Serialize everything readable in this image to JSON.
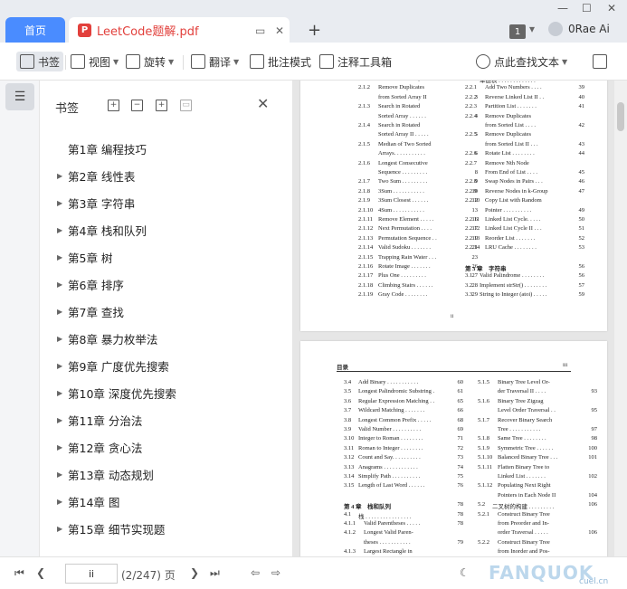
{
  "tabs": {
    "home_label": "首页",
    "doc_icon_text": "P",
    "doc_label": "LeetCode题解.pdf"
  },
  "titlebar": {
    "badge_number": "1",
    "user_name": "0Rae Ai"
  },
  "toolbar": {
    "bookmark": "书签",
    "view": "视图",
    "rotate": "旋转",
    "translate": "翻译",
    "annotate_mode": "批注模式",
    "annotate_tools": "注释工具箱",
    "search": "点此查找文本"
  },
  "panel": {
    "title": "书签",
    "items": [
      {
        "label": "第1章  编程技巧",
        "expandable": false
      },
      {
        "label": "第2章  线性表",
        "expandable": true
      },
      {
        "label": "第3章  字符串",
        "expandable": true
      },
      {
        "label": "第4章  栈和队列",
        "expandable": true
      },
      {
        "label": "第5章  树",
        "expandable": true
      },
      {
        "label": "第6章  排序",
        "expandable": true
      },
      {
        "label": "第7章  查找",
        "expandable": true
      },
      {
        "label": "第8章  暴力枚举法",
        "expandable": true
      },
      {
        "label": "第9章  广度优先搜索",
        "expandable": true
      },
      {
        "label": "第10章  深度优先搜索",
        "expandable": true
      },
      {
        "label": "第11章  分治法",
        "expandable": true
      },
      {
        "label": "第12章  贪心法",
        "expandable": true
      },
      {
        "label": "第13章  动态规划",
        "expandable": true
      },
      {
        "label": "第14章  图",
        "expandable": true
      },
      {
        "label": "第15章  细节实现题",
        "expandable": true
      }
    ]
  },
  "page1": {
    "left": [
      {
        "n": "",
        "t": "from Sorted Array",
        "p": "2"
      },
      {
        "n": "2.1.2",
        "t": "Remove      Duplicates",
        "p": ""
      },
      {
        "n": "",
        "t": "from Sorted Array II",
        "p": "3"
      },
      {
        "n": "2.1.3",
        "t": "Search      in      Rotated",
        "p": ""
      },
      {
        "n": "",
        "t": "Sorted Array . . . . . .",
        "p": "4"
      },
      {
        "n": "2.1.4",
        "t": "Search      in      Rotated",
        "p": ""
      },
      {
        "n": "",
        "t": "Sorted Array II . . . . .",
        "p": "5"
      },
      {
        "n": "2.1.5",
        "t": "Median of Two Sorted",
        "p": ""
      },
      {
        "n": "",
        "t": "Arrays. . . . . . . . . . .",
        "p": "6"
      },
      {
        "n": "2.1.6",
        "t": "Longest   Consecutive",
        "p": ""
      },
      {
        "n": "",
        "t": "Sequence . . . . . . . . .",
        "p": "8"
      },
      {
        "n": "2.1.7",
        "t": "Two Sum . . . . . . . . .",
        "p": "9"
      },
      {
        "n": "2.1.8",
        "t": "3Sum . . . . . . . . . . .",
        "p": "10"
      },
      {
        "n": "2.1.9",
        "t": "3Sum Closest . . . . . .",
        "p": "12"
      },
      {
        "n": "2.1.10",
        "t": "4Sum . . . . . . . . . . .",
        "p": "13"
      },
      {
        "n": "2.1.11",
        "t": "Remove Element . . . . .",
        "p": "16"
      },
      {
        "n": "2.1.12",
        "t": "Next Permutation . . . .",
        "p": "17"
      },
      {
        "n": "2.1.13",
        "t": "Permutation Sequence . .",
        "p": "19"
      },
      {
        "n": "2.1.14",
        "t": "Valid Sudoku . . . . . . .",
        "p": "21"
      },
      {
        "n": "2.1.15",
        "t": "Trapping Rain Water . . .",
        "p": "23"
      },
      {
        "n": "2.1.16",
        "t": "Rotate Image . . . . . . .",
        "p": "26"
      },
      {
        "n": "2.1.17",
        "t": "Plus One . . . . . . . . .",
        "p": "27"
      },
      {
        "n": "2.1.18",
        "t": "Climbing Stairs . . . . . .",
        "p": "28"
      },
      {
        "n": "2.1.19",
        "t": "Gray Code . . . . . . . .",
        "p": "29"
      }
    ],
    "right": [
      {
        "n": "2.2",
        "t": "单链表 . . . . . . . . . . . . .",
        "p": "38"
      },
      {
        "n": "2.2.1",
        "t": "Add Two Numbers . . . .",
        "p": "39"
      },
      {
        "n": "2.2.2",
        "t": "Reverse Linked List II . .",
        "p": "40"
      },
      {
        "n": "2.2.3",
        "t": "Partition List . . . . . . .",
        "p": "41"
      },
      {
        "n": "2.2.4",
        "t": "Remove      Duplicates",
        "p": ""
      },
      {
        "n": "",
        "t": "from Sorted List . . . .",
        "p": "42"
      },
      {
        "n": "2.2.5",
        "t": "Remove      Duplicates",
        "p": ""
      },
      {
        "n": "",
        "t": "from Sorted List II . . .",
        "p": "43"
      },
      {
        "n": "2.2.6",
        "t": "Rotate List . . . . . . . .",
        "p": "44"
      },
      {
        "n": "2.2.7",
        "t": "Remove   Nth   Node",
        "p": ""
      },
      {
        "n": "",
        "t": "From End of List . . . .",
        "p": "45"
      },
      {
        "n": "2.2.8",
        "t": "Swap Nodes in Pairs . . .",
        "p": "46"
      },
      {
        "n": "2.2.9",
        "t": "Reverse Nodes in k-Group",
        "p": "47"
      },
      {
        "n": "2.2.10",
        "t": "Copy List with Random",
        "p": ""
      },
      {
        "n": "",
        "t": "Pointer . . . . . . . . . .",
        "p": "49"
      },
      {
        "n": "2.2.11",
        "t": "Linked List Cycle. . . . .",
        "p": "50"
      },
      {
        "n": "2.2.12",
        "t": "Linked List Cycle II . . .",
        "p": "51"
      },
      {
        "n": "2.2.13",
        "t": "Reorder List . . . . . . .",
        "p": "52"
      },
      {
        "n": "2.2.14",
        "t": "LRU Cache . . . . . . . .",
        "p": "53"
      },
      {
        "n": "",
        "t": "",
        "p": ""
      },
      {
        "n": "第 3 章",
        "t": "字符串",
        "p": "56"
      },
      {
        "n": "3.1",
        "t": "Valid Palindrome . . . . . . . .",
        "p": "56"
      },
      {
        "n": "3.2",
        "t": "Implement strStr() . . . . . . . .",
        "p": "57"
      },
      {
        "n": "3.3",
        "t": "String to Integer (atoi) . . . . .",
        "p": "59"
      }
    ],
    "page_number": "ii"
  },
  "page2": {
    "header_left": "目录",
    "header_right": "iii",
    "left": [
      {
        "n": "3.4",
        "t": "Add Binary . . . . . . . . . . .",
        "p": "60"
      },
      {
        "n": "3.5",
        "t": "Longest Palindromic Substring .",
        "p": "61"
      },
      {
        "n": "3.6",
        "t": "Regular Expression Matching . .",
        "p": "65"
      },
      {
        "n": "3.7",
        "t": "Wildcard Matching . . . . . . .",
        "p": "66"
      },
      {
        "n": "3.8",
        "t": "Longest Common Prefix . . . . .",
        "p": "68"
      },
      {
        "n": "3.9",
        "t": "Valid Number . . . . . . . . . .",
        "p": "69"
      },
      {
        "n": "3.10",
        "t": "Integer to Roman . . . . . . . .",
        "p": "71"
      },
      {
        "n": "3.11",
        "t": "Roman to Integer . . . . . . . .",
        "p": "72"
      },
      {
        "n": "3.12",
        "t": "Count and Say. . . . . . . . . .",
        "p": "73"
      },
      {
        "n": "3.13",
        "t": "Anagrams . . . . . . . . . . . .",
        "p": "74"
      },
      {
        "n": "3.14",
        "t": "Simplify Path . . . . . . . . . .",
        "p": "75"
      },
      {
        "n": "3.15",
        "t": "Length of Last Word . . . . . .",
        "p": "76"
      },
      {
        "n": "",
        "t": "",
        "p": ""
      },
      {
        "n": "第 4 章",
        "t": "栈和队列",
        "p": "78"
      },
      {
        "n": "4.1",
        "t": "栈 . . . . . . . . . . . . . . . .",
        "p": "78"
      },
      {
        "n": "4.1.1",
        "t": "Valid Parentheses . . . . .",
        "p": "78"
      },
      {
        "n": "4.1.2",
        "t": "Longest   Valid   Paren-",
        "p": ""
      },
      {
        "n": "",
        "t": "theses . . . . . . . . . . .",
        "p": "79"
      },
      {
        "n": "4.1.3",
        "t": "Largest   Rectangle   in",
        "p": ""
      }
    ],
    "right": [
      {
        "n": "5.1.5",
        "t": "Binary Tree Level Or-",
        "p": ""
      },
      {
        "n": "",
        "t": "der Traversal II . . . .",
        "p": "93"
      },
      {
        "n": "5.1.6",
        "t": "Binary   Tree   Zigzag",
        "p": ""
      },
      {
        "n": "",
        "t": "Level Order Traversal . .",
        "p": "95"
      },
      {
        "n": "5.1.7",
        "t": "Recover Binary Search",
        "p": ""
      },
      {
        "n": "",
        "t": "Tree . . . . . . . . . . .",
        "p": "97"
      },
      {
        "n": "5.1.8",
        "t": "Same Tree . . . . . . . .",
        "p": "98"
      },
      {
        "n": "5.1.9",
        "t": "Symmetric Tree . . . . . .",
        "p": "100"
      },
      {
        "n": "5.1.10",
        "t": "Balanced Binary Tree . . .",
        "p": "101"
      },
      {
        "n": "5.1.11",
        "t": "Flatten Binary Tree to",
        "p": ""
      },
      {
        "n": "",
        "t": "Linked List . . . . . . .",
        "p": "102"
      },
      {
        "n": "5.1.12",
        "t": "Populating Next Right",
        "p": ""
      },
      {
        "n": "",
        "t": "Pointers in Each Node II",
        "p": "104"
      },
      {
        "n": "5.2",
        "t": "二叉树的构建 . . . . . . . . .",
        "p": "106"
      },
      {
        "n": "5.2.1",
        "t": "Construct Binary Tree",
        "p": ""
      },
      {
        "n": "",
        "t": "from Preorder and In-",
        "p": ""
      },
      {
        "n": "",
        "t": "order Traversal . . . . .",
        "p": "106"
      },
      {
        "n": "5.2.2",
        "t": "Construct Binary Tree",
        "p": ""
      },
      {
        "n": "",
        "t": "from Inorder and Pos-",
        "p": ""
      }
    ]
  },
  "status": {
    "page_input": "ii",
    "page_count": "(2/247) 页"
  },
  "watermark": {
    "text": "FANQUOK",
    "sub": "cuel.cn"
  },
  "colors": {
    "accent": "#4a8cff",
    "pdf_red": "#e2403c",
    "doc_bg": "#e6e6e6"
  }
}
